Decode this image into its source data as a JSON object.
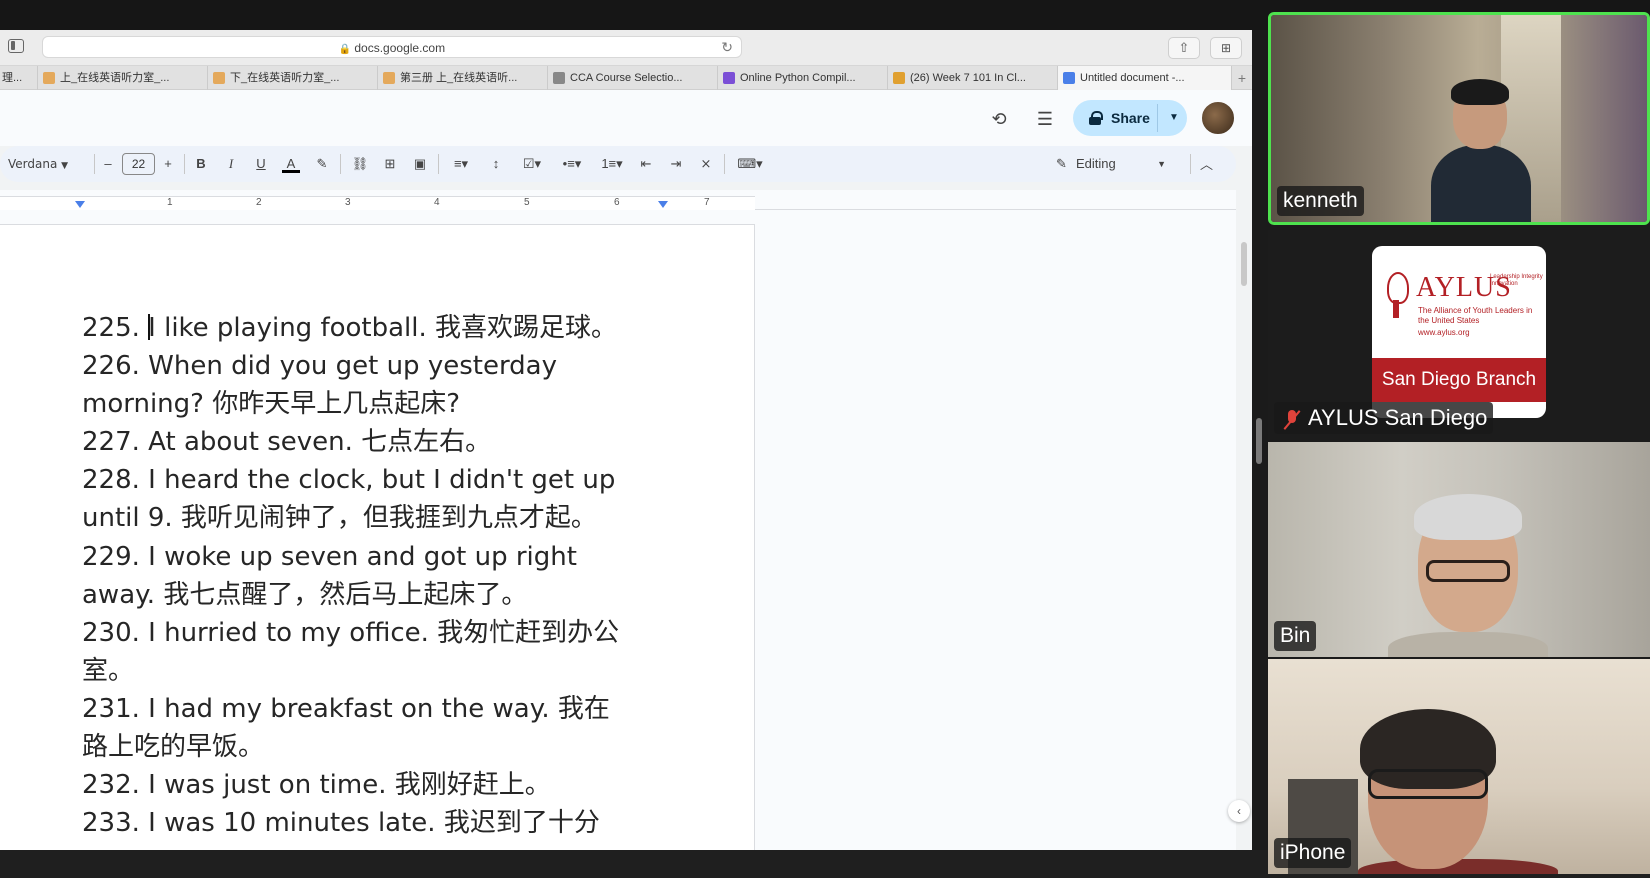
{
  "browser": {
    "address": "docs.google.com",
    "tabs": [
      {
        "label": "理...",
        "icon_color": "#e4a95c"
      },
      {
        "label": "上_在线英语听力室_...",
        "icon_color": "#e4a95c"
      },
      {
        "label": "下_在线英语听力室_...",
        "icon_color": "#e4a95c"
      },
      {
        "label": "第三册 上_在线英语听...",
        "icon_color": "#e4a95c"
      },
      {
        "label": "CCA Course Selectio...",
        "icon_color": "#888888"
      },
      {
        "label": "Online Python Compil...",
        "icon_color": "#7b4fd6"
      },
      {
        "label": "(26) Week 7 101 In Cl...",
        "icon_color": "#e0a030"
      },
      {
        "label": "Untitled document -...",
        "icon_color": "#4a7fe8"
      }
    ],
    "new_tab": "+"
  },
  "docs": {
    "share_label": "Share",
    "font_name": "Verdana",
    "font_size": "22",
    "editing_label": "Editing",
    "ruler_numbers": [
      "1",
      "2",
      "3",
      "4",
      "5",
      "6",
      "7"
    ],
    "lines": [
      "225. I like playing football. 我喜欢踢足球。",
      "226. When did you get up yesterday",
      "morning? 你昨天早上几点起床?",
      "227. At about seven. 七点左右。",
      "228. I heard the clock, but I didn't get up",
      "until 9. 我听见闹钟了，但我捱到九点才起。",
      "229. I woke up seven and got up right",
      "away. 我七点醒了，然后马上起床了。",
      "230. I hurried to my office. 我匆忙赶到办公",
      "室。",
      "231. I had my breakfast on the way. 我在",
      "路上吃的早饭。",
      "232. I was just on time. 我刚好赶上。",
      "233. I was 10 minutes late. 我迟到了十分"
    ],
    "first_line_prefix": "225. ",
    "first_line_rest": "I like playing football. 我喜欢踢足球。"
  },
  "participants": [
    {
      "name": "kenneth",
      "speaking": true
    },
    {
      "name": "AYLUS San Diego",
      "muted": true
    },
    {
      "name": "Bin"
    },
    {
      "name": "iPhone"
    }
  ],
  "aylus_logo": {
    "title": "AYLUS",
    "tagline": "Leadership Integrity Innovation",
    "subtitle": "The Alliance of Youth Leaders in the United States",
    "url": "www.aylus.org",
    "branch": "San Diego Branch"
  },
  "colors": {
    "share_bg": "#c2e7ff",
    "toolbar_bg": "#edf2fa",
    "speaking_border": "#4ee24e",
    "aylus_red": "#b32025"
  }
}
